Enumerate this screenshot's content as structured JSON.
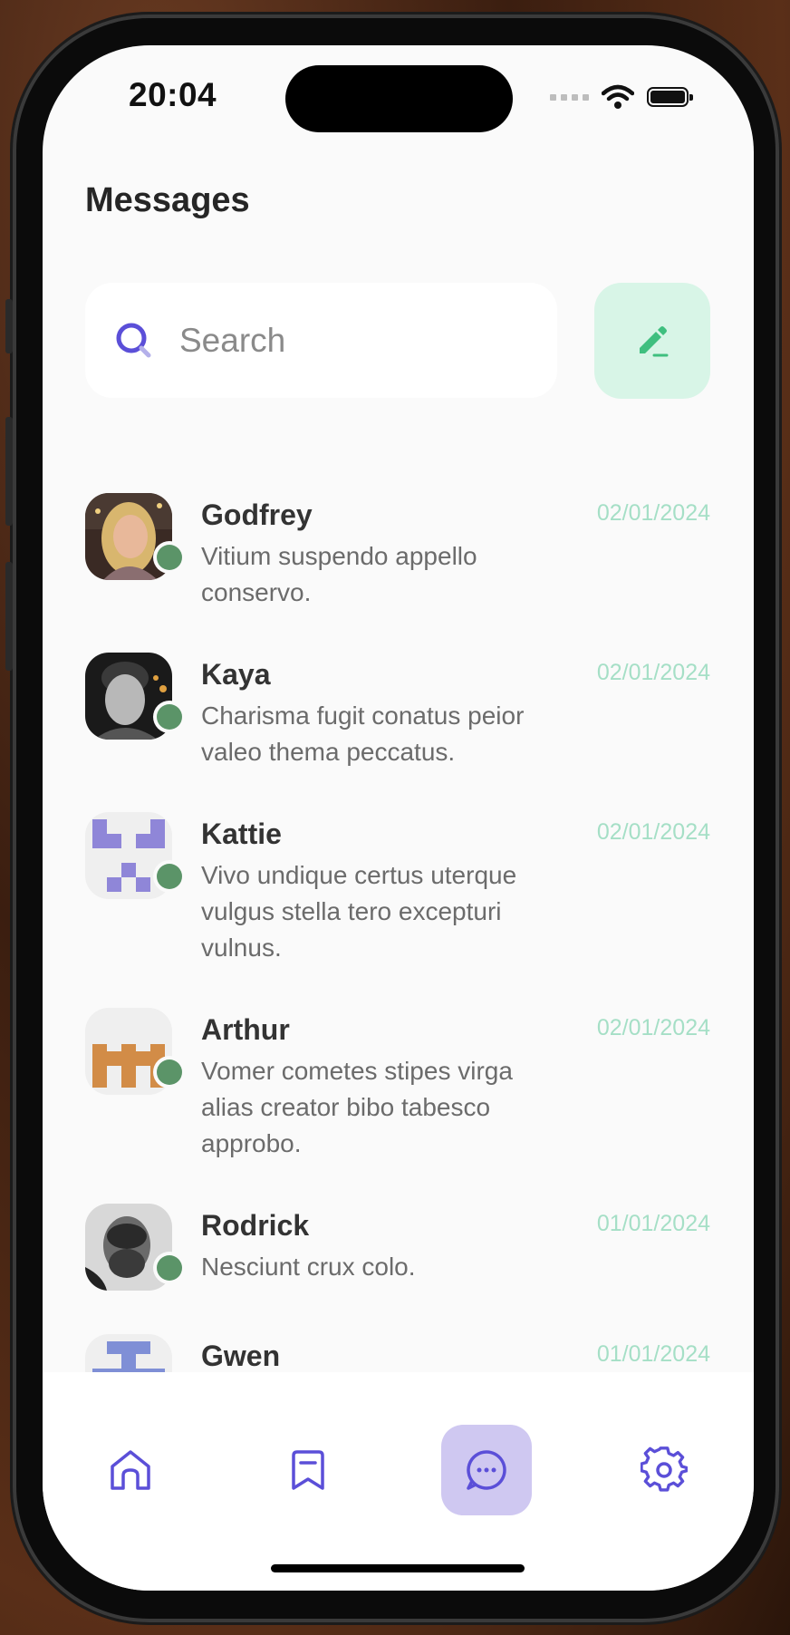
{
  "status_bar": {
    "time": "20:04"
  },
  "header": {
    "title": "Messages"
  },
  "search": {
    "placeholder": "Search"
  },
  "conversations": [
    {
      "name": "Godfrey",
      "preview": "Vitium suspendo appello conservo.",
      "date": "02/01/2024",
      "online": true,
      "avatar": "photo-woman-blonde"
    },
    {
      "name": "Kaya",
      "preview": "Charisma fugit conatus peior valeo thema peccatus.",
      "date": "02/01/2024",
      "online": true,
      "avatar": "photo-man-bw"
    },
    {
      "name": "Kattie",
      "preview": "Vivo undique certus uterque vulgus stella tero excepturi vulnus.",
      "date": "02/01/2024",
      "online": true,
      "avatar": "identicon-purple"
    },
    {
      "name": "Arthur",
      "preview": "Vomer cometes stipes virga alias creator bibo tabesco approbo.",
      "date": "02/01/2024",
      "online": true,
      "avatar": "identicon-orange"
    },
    {
      "name": "Rodrick",
      "preview": "Nesciunt crux colo.",
      "date": "01/01/2024",
      "online": true,
      "avatar": "photo-man-beard-bw"
    },
    {
      "name": "Gwen",
      "preview": "",
      "date": "01/01/2024",
      "online": false,
      "avatar": "identicon-blue"
    }
  ],
  "bottom_nav": [
    {
      "icon": "home-icon",
      "active": false
    },
    {
      "icon": "bookmark-icon",
      "active": false
    },
    {
      "icon": "chat-bubble-icon",
      "active": true
    },
    {
      "icon": "gear-icon",
      "active": false
    }
  ],
  "colors": {
    "accent": "#5b4fd8",
    "compose_bg": "#d8f5e7",
    "compose_icon": "#3fbf7f",
    "date": "#a5dfc6",
    "online_dot": "#5b9468",
    "active_nav_bg": "#cfc8f1"
  }
}
